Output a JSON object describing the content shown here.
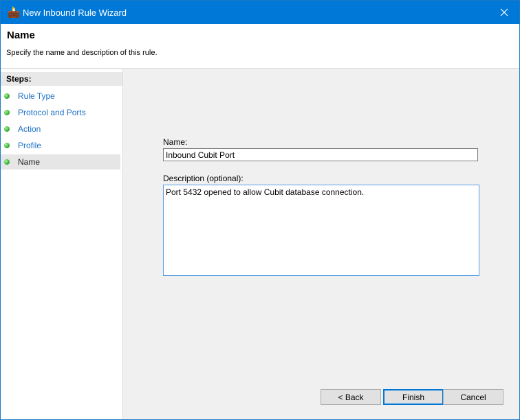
{
  "window": {
    "title": "New Inbound Rule Wizard",
    "accent_color": "#0078d7"
  },
  "header": {
    "title": "Name",
    "description": "Specify the name and description of this rule."
  },
  "steps": {
    "title": "Steps:",
    "items": [
      {
        "label": "Rule Type",
        "current": false
      },
      {
        "label": "Protocol and Ports",
        "current": false
      },
      {
        "label": "Action",
        "current": false
      },
      {
        "label": "Profile",
        "current": false
      },
      {
        "label": "Name",
        "current": true
      }
    ]
  },
  "form": {
    "name_label": "Name:",
    "name_value": "Inbound Cubit Port",
    "description_label": "Description (optional):",
    "description_value": "Port 5432 opened to allow Cubit database connection."
  },
  "buttons": {
    "back": "< Back",
    "finish": "Finish",
    "cancel": "Cancel"
  }
}
